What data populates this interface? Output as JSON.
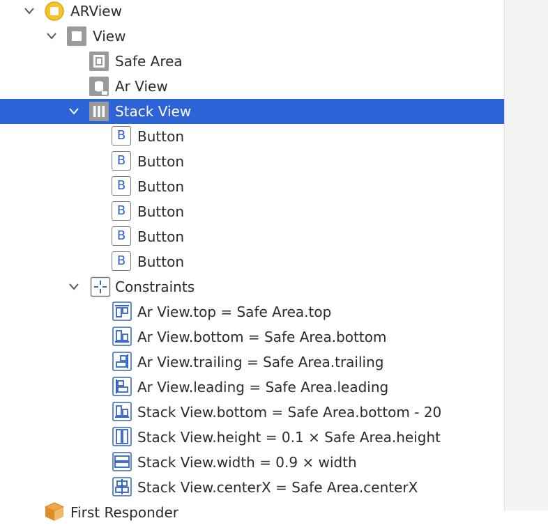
{
  "tree": {
    "arview": {
      "label": "ARView"
    },
    "view": {
      "label": "View"
    },
    "safe_area": {
      "label": "Safe Area"
    },
    "ar_view": {
      "label": "Ar View"
    },
    "stack_view": {
      "label": "Stack View"
    },
    "buttons": [
      {
        "label": "Button",
        "icon_letter": "B"
      },
      {
        "label": "Button",
        "icon_letter": "B"
      },
      {
        "label": "Button",
        "icon_letter": "B"
      },
      {
        "label": "Button",
        "icon_letter": "B"
      },
      {
        "label": "Button",
        "icon_letter": "B"
      },
      {
        "label": "Button",
        "icon_letter": "B"
      }
    ],
    "constraints_group": {
      "label": "Constraints"
    },
    "constraints": [
      {
        "label": "Ar View.top = Safe Area.top",
        "icon": "align-top-icon"
      },
      {
        "label": "Ar View.bottom = Safe Area.bottom",
        "icon": "align-bottom-icon"
      },
      {
        "label": "Ar View.trailing = Safe Area.trailing",
        "icon": "align-trailing-icon"
      },
      {
        "label": "Ar View.leading = Safe Area.leading",
        "icon": "align-leading-icon"
      },
      {
        "label": "Stack View.bottom = Safe Area.bottom - 20",
        "icon": "align-bottom-icon"
      },
      {
        "label": "Stack View.height = 0.1 × Safe Area.height",
        "icon": "height-icon"
      },
      {
        "label": "Stack View.width = 0.9 × width",
        "icon": "width-icon"
      },
      {
        "label": "Stack View.centerX = Safe Area.centerX",
        "icon": "center-x-icon"
      }
    ],
    "first_responder": {
      "label": "First Responder"
    }
  },
  "colors": {
    "selection": "#2d63d6",
    "accent": "#2f63c8",
    "scene_icon": "#f6c22d"
  }
}
